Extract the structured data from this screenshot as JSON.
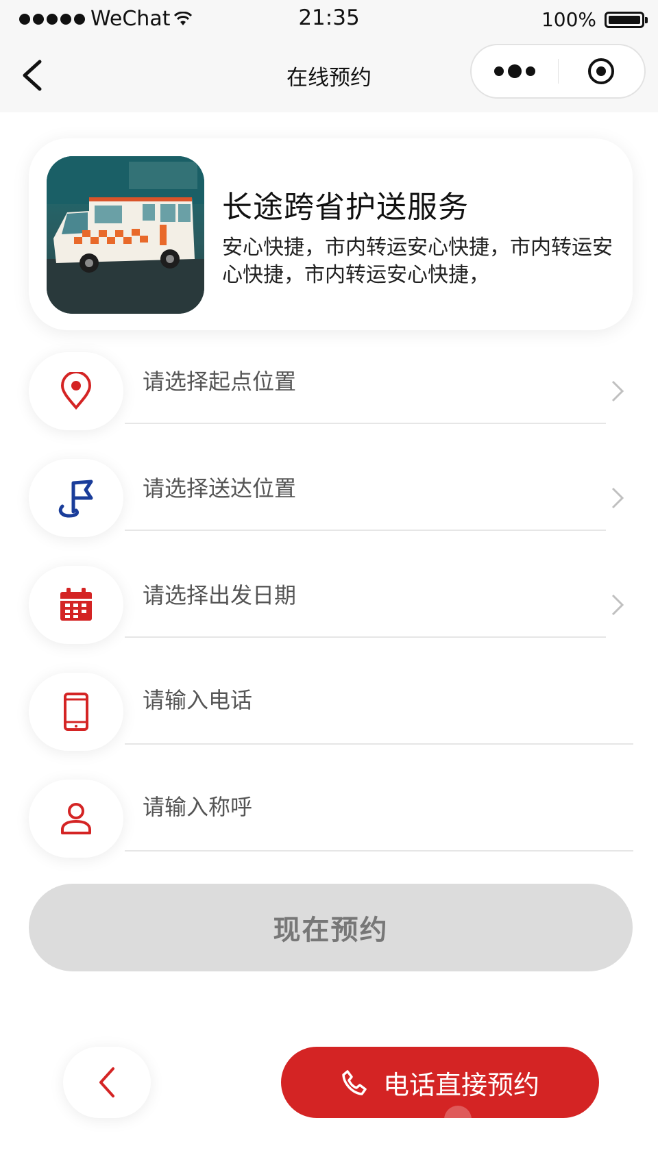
{
  "status_bar": {
    "carrier": "WeChat",
    "time": "21:35",
    "battery": "100%"
  },
  "nav": {
    "title": "在线预约"
  },
  "service": {
    "title": "长途跨省护送服务",
    "description": "安心快捷，市内转运安心快捷，市内转运安心快捷，市内转运安心快捷，"
  },
  "form": {
    "start_location": "请选择起点位置",
    "destination": "请选择送达位置",
    "departure_date": "请选择出发日期",
    "phone_placeholder": "请输入电话",
    "name_placeholder": "请输入称呼"
  },
  "actions": {
    "submit_label": "现在预约",
    "call_label": "电话直接预约"
  },
  "colors": {
    "accent": "#d42424",
    "navy": "#1a3d9a",
    "disabled_button": "#dcdcdc"
  },
  "icons": {
    "start": "location-pin-icon",
    "destination": "flag-icon",
    "date": "calendar-icon",
    "phone": "mobile-phone-icon",
    "name": "user-icon"
  }
}
